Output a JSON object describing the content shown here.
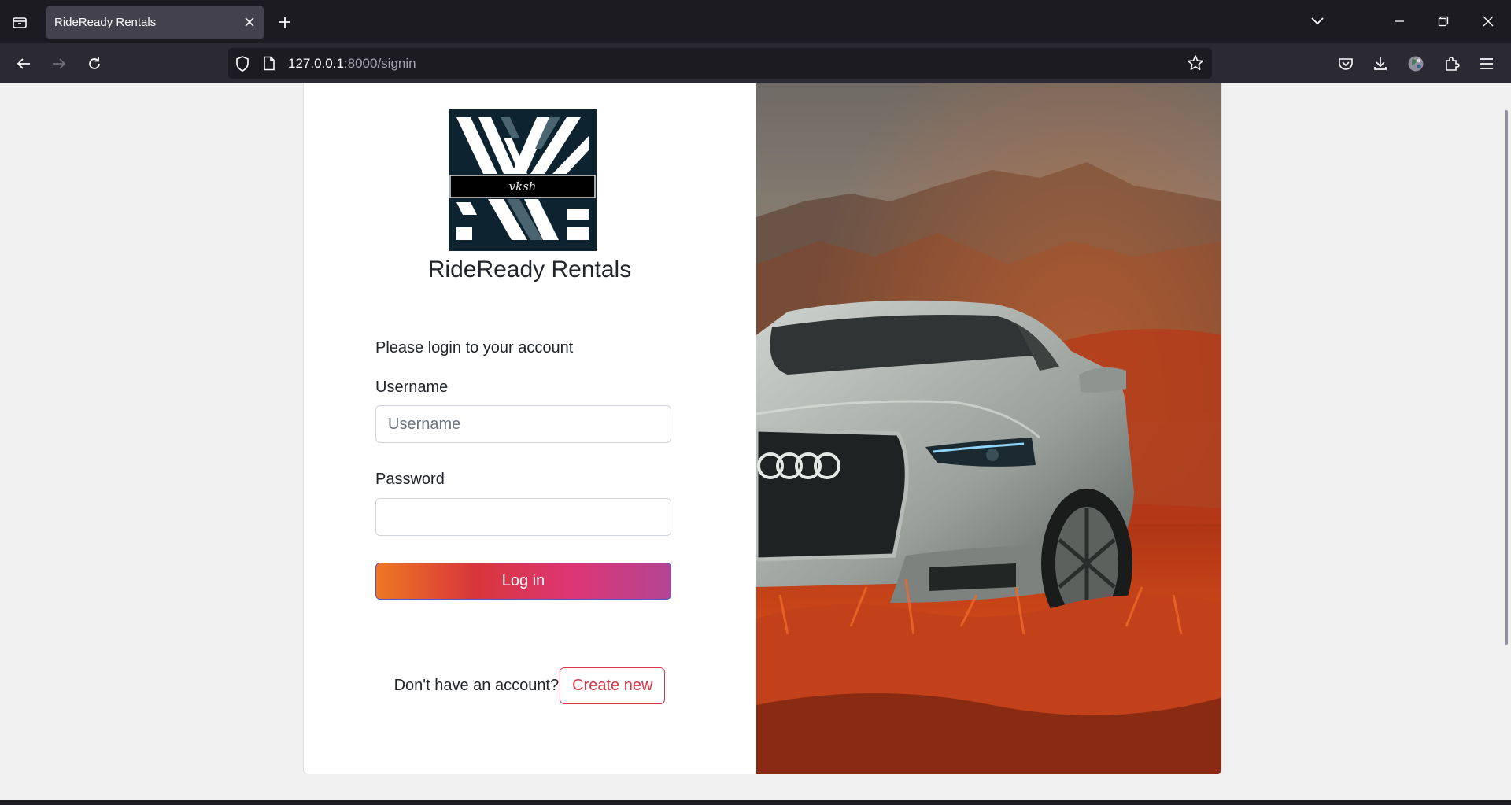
{
  "browser": {
    "tab_title": "RideReady Rentals",
    "url_host": "127.0.0.1",
    "url_path": ":8000/signin"
  },
  "brand": {
    "name": "RideReady Rentals",
    "logo_text": "vksh"
  },
  "login_form": {
    "prompt": "Please login to your account",
    "username_label": "Username",
    "username_placeholder": "Username",
    "username_value": "",
    "password_label": "Password",
    "password_value": "",
    "submit_label": "Log in"
  },
  "signup": {
    "question": "Don't have an account?",
    "create_label": "Create new"
  },
  "colors": {
    "gradient": [
      "#ee7724",
      "#d8363a",
      "#dd3675",
      "#b44593"
    ],
    "danger": "#dc3545",
    "chrome_bg": "#1c1b22"
  },
  "icons": [
    "tab-list-icon",
    "close-icon",
    "plus-icon",
    "chevron-down-icon",
    "minimize-icon",
    "restore-icon",
    "back-icon",
    "forward-icon",
    "reload-icon",
    "shield-icon",
    "page-icon",
    "star-icon",
    "pocket-icon",
    "download-icon",
    "profile-icon",
    "extensions-icon",
    "menu-icon"
  ]
}
